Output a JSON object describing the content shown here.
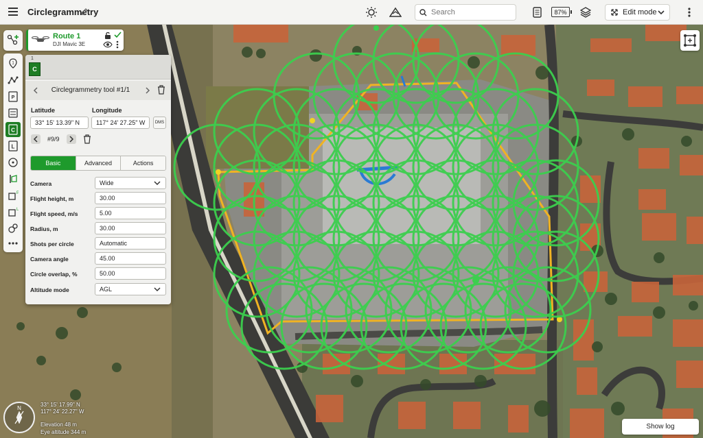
{
  "app": {
    "title": "Circlegrammetry"
  },
  "topbar": {
    "search_placeholder": "Search",
    "battery": "87%",
    "mode": "Edit mode",
    "icons": [
      "menu-icon",
      "pencil-icon",
      "sun-icon",
      "terrain-icon",
      "search-icon",
      "document-icon",
      "battery-icon",
      "layers-icon",
      "chevron-down-icon",
      "more-vertical-icon"
    ]
  },
  "route": {
    "name": "Route 1",
    "drone": "DJI Mavic 3E"
  },
  "panel": {
    "thumb_index": "1",
    "thumb_label": "C",
    "tool_title": "Circlegrammetry tool #1/1",
    "latitude_label": "Latitude",
    "longitude_label": "Longitude",
    "latitude": "33° 15' 13.39\" N",
    "longitude": "117° 24' 27.25\" W",
    "dms": "DMS",
    "point_counter": "#9/9",
    "tabs": [
      "Basic",
      "Advanced",
      "Actions"
    ],
    "fields": [
      {
        "label": "Camera",
        "value": "Wide",
        "type": "select"
      },
      {
        "label": "Flight height, m",
        "value": "30.00",
        "type": "input"
      },
      {
        "label": "Flight speed, m/s",
        "value": "5.00",
        "type": "input"
      },
      {
        "label": "Radius, m",
        "value": "30.00",
        "type": "input"
      },
      {
        "label": "Shots per circle",
        "value": "Automatic",
        "type": "input"
      },
      {
        "label": "Camera angle",
        "value": "45.00",
        "type": "input"
      },
      {
        "label": "Circle overlap, %",
        "value": "50.00",
        "type": "input"
      },
      {
        "label": "Altitude mode",
        "value": "AGL",
        "type": "select"
      }
    ]
  },
  "status": {
    "compass_north": "N",
    "lat": "33° 15' 17.99\" N",
    "lon": "117° 24' 22.27\" W",
    "elevation": "Elevation 48 m",
    "eye_altitude": "Eye altitude 344 m"
  },
  "show_log": "Show log",
  "colors": {
    "accent": "#1e9a2c",
    "circle": "#3ccf4e",
    "boundary": "#f0b323",
    "flightline": "#2a7bd4"
  }
}
